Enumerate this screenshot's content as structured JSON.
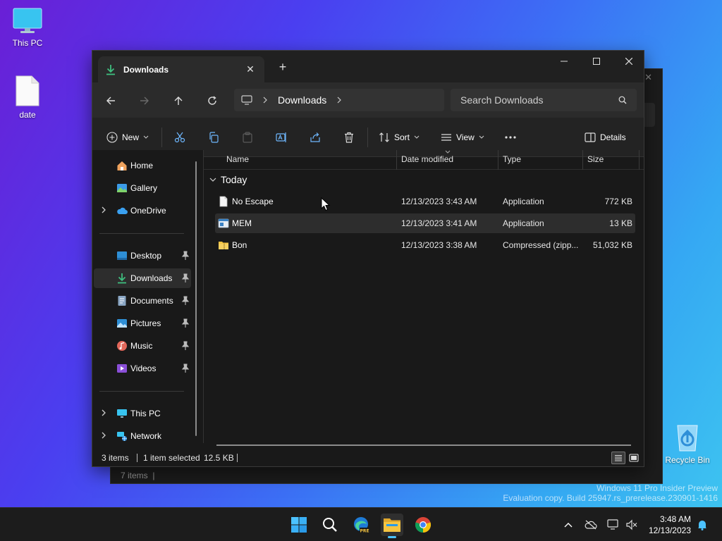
{
  "desktop": {
    "icons": [
      {
        "label": "This PC",
        "icon": "monitor-icon"
      },
      {
        "label": "date",
        "icon": "file-icon"
      },
      {
        "label": "Recycle Bin",
        "icon": "recycle-bin-icon"
      }
    ],
    "watermark": {
      "line1": "Windows 11 Pro Insider Preview",
      "line2": "Evaluation copy. Build 25947.rs_prerelease.230901-1416"
    }
  },
  "back_window": {
    "status": "7 items"
  },
  "window": {
    "tab": {
      "title": "Downloads",
      "icon": "download-icon"
    },
    "address": {
      "crumb": "Downloads",
      "search_placeholder": "Search Downloads"
    },
    "toolbar": {
      "new_label": "New",
      "sort_label": "Sort",
      "view_label": "View",
      "details_label": "Details"
    },
    "nav": {
      "items": [
        {
          "label": "Home",
          "icon": "home-icon"
        },
        {
          "label": "Gallery",
          "icon": "gallery-icon"
        },
        {
          "label": "OneDrive",
          "icon": "cloud-icon"
        },
        {
          "label": "Desktop",
          "icon": "desktop-icon"
        },
        {
          "label": "Downloads",
          "icon": "download-icon"
        },
        {
          "label": "Documents",
          "icon": "document-icon"
        },
        {
          "label": "Pictures",
          "icon": "pictures-icon"
        },
        {
          "label": "Music",
          "icon": "music-icon"
        },
        {
          "label": "Videos",
          "icon": "videos-icon"
        },
        {
          "label": "This PC",
          "icon": "monitor-icon"
        },
        {
          "label": "Network",
          "icon": "network-icon"
        }
      ]
    },
    "columns": {
      "name": "Name",
      "date": "Date modified",
      "type": "Type",
      "size": "Size"
    },
    "group": "Today",
    "files": [
      {
        "name": "No Escape",
        "date": "12/13/2023 3:43 AM",
        "type": "Application",
        "size": "772 KB",
        "icon": "file-icon"
      },
      {
        "name": "MEM",
        "date": "12/13/2023 3:41 AM",
        "type": "Application",
        "size": "13 KB",
        "icon": "app-icon"
      },
      {
        "name": "Bon",
        "date": "12/13/2023 3:38 AM",
        "type": "Compressed (zipp...",
        "size": "51,032 KB",
        "icon": "zip-folder-icon"
      }
    ],
    "status": {
      "count": "3 items",
      "selection": "1 item selected",
      "size": "12.5 KB"
    }
  },
  "taskbar": {
    "edge_badge": "PRE",
    "time": "3:48 AM",
    "date": "12/13/2023"
  },
  "colors": {
    "accent": "#4cc2ff",
    "download_green": "#3fbf7f",
    "folder_yellow": "#f5c542"
  }
}
